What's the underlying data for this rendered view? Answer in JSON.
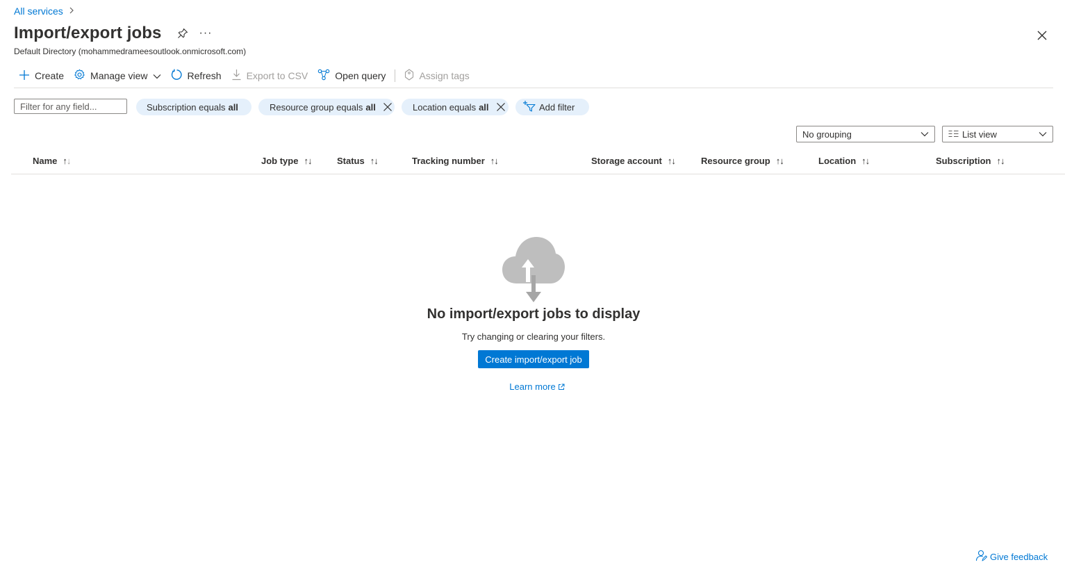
{
  "breadcrumb": {
    "root": "All services"
  },
  "header": {
    "title": "Import/export jobs",
    "subtitle": "Default Directory (mohammedrameesoutlook.onmicrosoft.com)",
    "more": "···"
  },
  "toolbar": {
    "create": "Create",
    "manage_view": "Manage view",
    "refresh": "Refresh",
    "export_csv": "Export to CSV",
    "open_query": "Open query",
    "assign_tags": "Assign tags"
  },
  "filters": {
    "search_placeholder": "Filter for any field...",
    "pills": [
      {
        "label": "Subscription equals",
        "value": "all",
        "removable": false
      },
      {
        "label": "Resource group equals",
        "value": "all",
        "removable": true
      },
      {
        "label": "Location equals",
        "value": "all",
        "removable": true
      }
    ],
    "add_filter": "Add filter"
  },
  "view_controls": {
    "grouping": "No grouping",
    "view": "List view"
  },
  "table": {
    "columns": [
      "Name",
      "Job type",
      "Status",
      "Tracking number",
      "Storage account",
      "Resource group",
      "Location",
      "Subscription"
    ]
  },
  "empty_state": {
    "title": "No import/export jobs to display",
    "subtitle": "Try changing or clearing your filters.",
    "button": "Create import/export job",
    "learn_more": "Learn more"
  },
  "feedback": "Give feedback",
  "colors": {
    "accent": "#0078d4",
    "pill_bg": "#e5f0fb",
    "text": "#323130"
  }
}
